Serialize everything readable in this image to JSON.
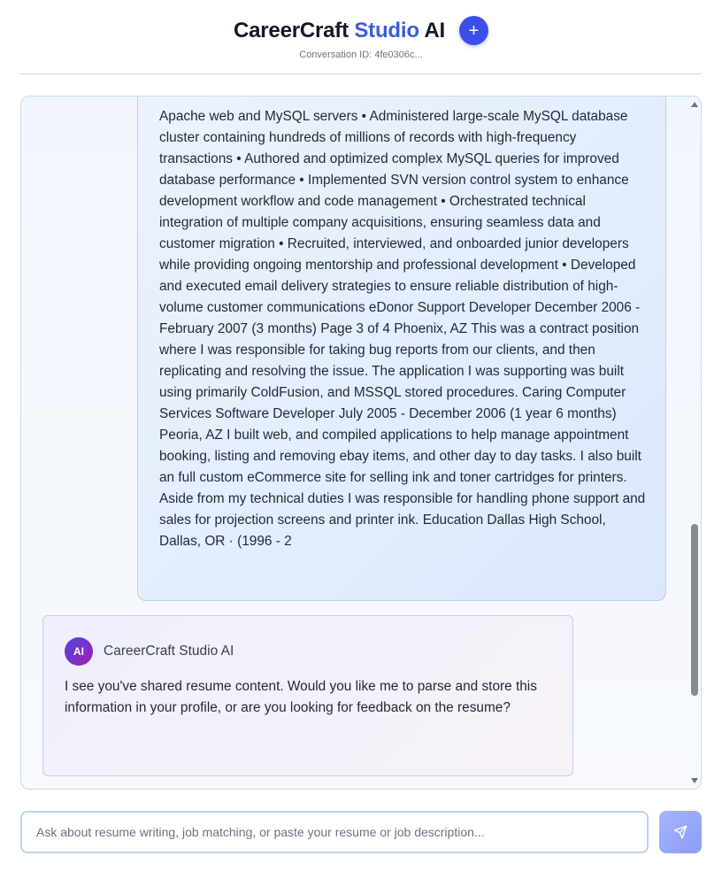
{
  "header": {
    "title_main": "CareerCraft",
    "title_accent": "Studio",
    "title_end": "AI",
    "new_button_label": "+",
    "conversation_id": "Conversation ID: 4fe0306c..."
  },
  "messages": [
    {
      "role": "user",
      "text": "Apache web and MySQL servers • Administered large-scale MySQL database cluster containing hundreds of millions of records with high-frequency transactions • Authored and optimized complex MySQL queries for improved database performance • Implemented SVN version control system to enhance development workflow and code management • Orchestrated technical integration of multiple company acquisitions, ensuring seamless data and customer migration • Recruited, interviewed, and onboarded junior developers while providing ongoing mentorship and professional development • Developed and executed email delivery strategies to ensure reliable distribution of high-volume customer communications eDonor Support Developer December 2006 - February 2007 (3 months) Page 3 of 4 Phoenix, AZ This was a contract position where I was responsible for taking bug reports from our clients, and then replicating and resolving the issue. The application I was supporting was built using primarily ColdFusion, and MSSQL stored procedures. Caring Computer Services Software Developer July 2005 - December 2006 (1 year 6 months) Peoria, AZ I built web, and compiled applications to help manage appointment booking, listing and removing ebay items, and other day to day tasks. I also built an full custom eCommerce site for selling ink and toner cartridges for printers. Aside from my technical duties I was responsible for handling phone support and sales for projection screens and printer ink. Education Dallas High School, Dallas, OR · (1996 - 2"
    },
    {
      "role": "assistant",
      "avatar": "AI",
      "name": "CareerCraft Studio AI",
      "text": "I see you've shared resume content. Would you like me to parse and store this information in your profile, or are you looking for feedback on the resume?"
    }
  ],
  "composer": {
    "placeholder": "Ask about resume writing, job matching, or paste your resume or job description...",
    "value": "",
    "send_icon": "send-icon"
  },
  "colors": {
    "accent": "#3b5bdb",
    "button": "#3b4fe8",
    "send_button": "#a5b4fc"
  }
}
